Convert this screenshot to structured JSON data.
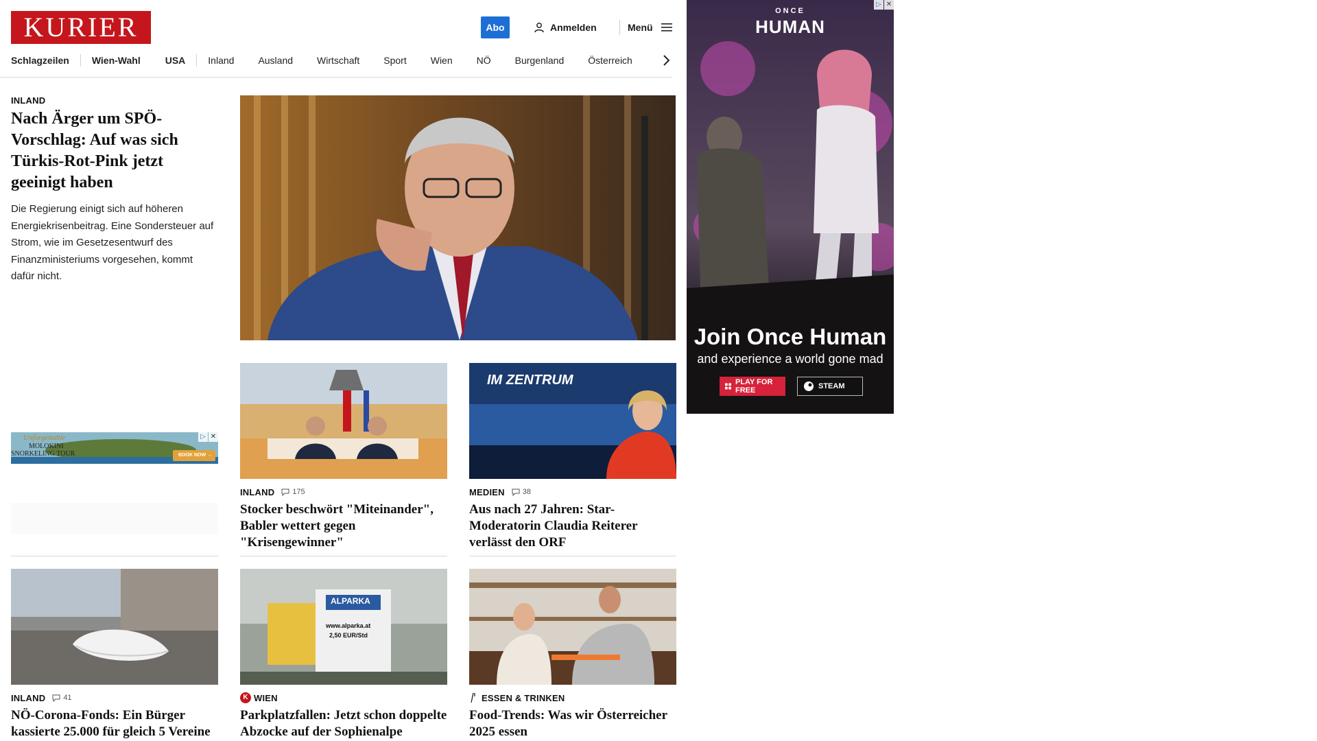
{
  "header": {
    "logo": "KURIER",
    "abo_label": "Abo",
    "login_label": "Anmelden",
    "menu_label": "Menü",
    "nav": [
      "Schlagzeilen",
      "Wien-Wahl",
      "USA",
      "Inland",
      "Ausland",
      "Wirtschaft",
      "Sport",
      "Wien",
      "NÖ",
      "Burgenland",
      "Österreich"
    ]
  },
  "lead": {
    "kicker": "INLAND",
    "title": "Nach Ärger um SPÖ-Vorschlag: Auf was sich Türkis-Rot-Pink jetzt geeinigt haben",
    "teaser": "Die Regierung einigt sich auf höheren Energiekrisenbeitrag. Eine Sondersteuer auf Strom, wie im Gesetzesentwurf des Finanzministeriums vorgesehen, kommt dafür nicht."
  },
  "left_ad": {
    "line1": "Unforgettable",
    "line2": "MOLOKINI",
    "line3": "SNORKELING TOUR",
    "cta": "BOOK NOW →"
  },
  "cards": [
    {
      "kicker": "INLAND",
      "comments": "175",
      "title": "Stocker beschwört \"Miteinander\", Babler wettert gegen \"Krisengewinner\""
    },
    {
      "kicker": "MEDIEN",
      "comments": "38",
      "title": "Aus nach 27 Jahren: Star-Moderatorin Claudia Reiterer verlässt den ORF",
      "image_text": "IM ZENTRUM"
    },
    {
      "kicker": "INLAND",
      "comments": "41",
      "title": "NÖ-Corona-Fonds: Ein Bürger kassierte 25.000 für gleich 5 Vereine"
    },
    {
      "kicker": "WIEN",
      "title": "Parkplatzfallen: Jetzt schon doppelte Abzocke auf der Sophienalpe",
      "image_text_1": "ALPARKA",
      "image_text_2": "www.alparka.at",
      "image_text_3": "2,50 EUR/Std"
    },
    {
      "kicker": "ESSEN & TRINKEN",
      "title": "Food-Trends: Was wir Österreicher 2025 essen"
    }
  ],
  "right_ad": {
    "brand_small": "ONCE",
    "brand_big": "HUMAN",
    "headline": "Join Once Human",
    "subline": "and experience a world gone mad",
    "btn_play": "PLAY FOR FREE",
    "btn_steam": "STEAM"
  },
  "colors": {
    "brand_red": "#c4161c",
    "abo_blue": "#1d6fd6"
  }
}
